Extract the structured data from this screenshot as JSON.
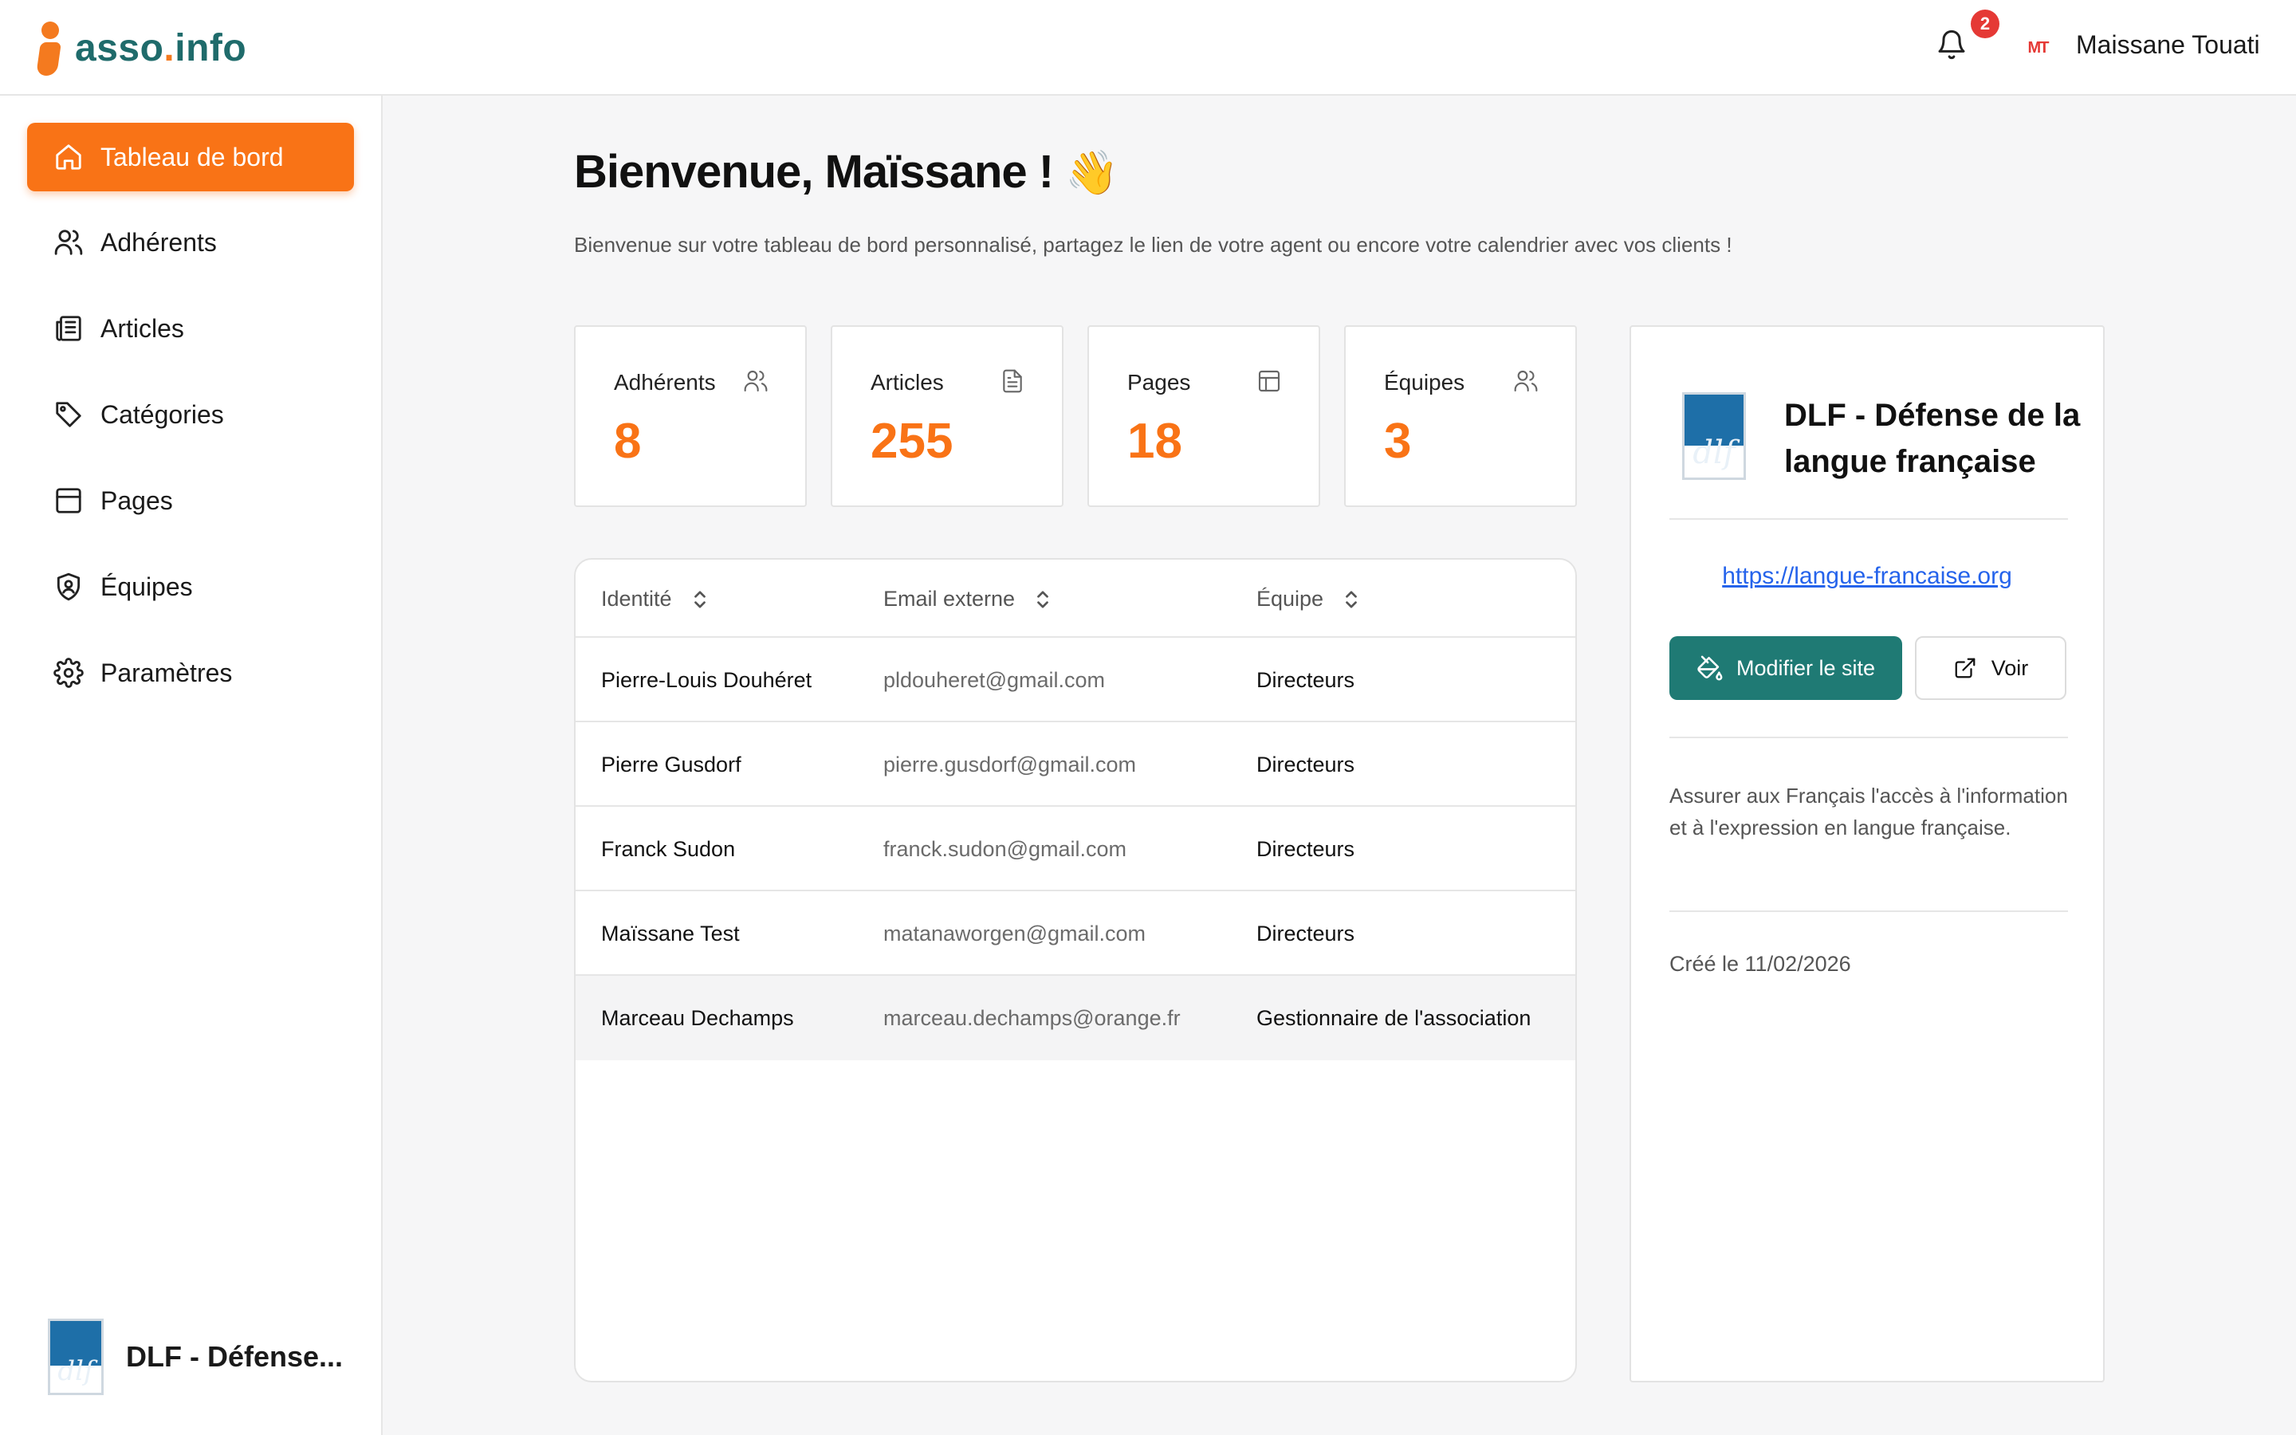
{
  "app": {
    "logo_main": "asso",
    "logo_dot": ".",
    "logo_tld": "info",
    "accent_color": "#f97316",
    "brand_color": "#1f7a74"
  },
  "header": {
    "notification_count": "2",
    "avatar_initials": "MT",
    "user_name": "Maissane Touati",
    "icons": [
      "bell-icon"
    ]
  },
  "sidebar": {
    "items": [
      {
        "label": "Tableau de bord",
        "icon": "home-icon",
        "active": true
      },
      {
        "label": "Adhérents",
        "icon": "users-icon"
      },
      {
        "label": "Articles",
        "icon": "newspaper-icon"
      },
      {
        "label": "Catégories",
        "icon": "tag-icon"
      },
      {
        "label": "Pages",
        "icon": "layout-icon"
      },
      {
        "label": "Équipes",
        "icon": "shield-user-icon"
      },
      {
        "label": "Paramètres",
        "icon": "gear-icon"
      }
    ],
    "org_name": "DLF - Défense..."
  },
  "main": {
    "welcome": "Bienvenue, Maïssane !",
    "wave": "👋",
    "subtitle": "Bienvenue sur votre tableau de bord personnalisé, partagez le lien de votre agent ou encore votre calendrier avec vos clients !",
    "stats": [
      {
        "label": "Adhérents",
        "value": "8",
        "icon": "users-icon"
      },
      {
        "label": "Articles",
        "value": "255",
        "icon": "file-text-icon"
      },
      {
        "label": "Pages",
        "value": "18",
        "icon": "layout-icon"
      },
      {
        "label": "Équipes",
        "value": "3",
        "icon": "users-icon"
      }
    ],
    "table": {
      "columns": [
        "Identité",
        "Email externe",
        "Équipe"
      ],
      "rows": [
        {
          "name": "Pierre-Louis Douhéret",
          "email": "pldouheret@gmail.com",
          "team": "Directeurs"
        },
        {
          "name": "Pierre Gusdorf",
          "email": "pierre.gusdorf@gmail.com",
          "team": "Directeurs"
        },
        {
          "name": "Franck Sudon",
          "email": "franck.sudon@gmail.com",
          "team": "Directeurs"
        },
        {
          "name": "Maïssane Test",
          "email": "matanaworgen@gmail.com",
          "team": "Directeurs"
        },
        {
          "name": "Marceau Dechamps",
          "email": "marceau.dechamps@orange.fr",
          "team": "Gestionnaire de l'association"
        }
      ]
    }
  },
  "org_card": {
    "logo_text": "dlf",
    "title": "DLF - Défense de la langue française",
    "link": "https://langue-francaise.org",
    "edit_label": "Modifier le site",
    "view_label": "Voir",
    "description": "Assurer aux Français l'accès à l'information et à l'expression en langue française.",
    "created": "Créé le 11/02/2026"
  }
}
